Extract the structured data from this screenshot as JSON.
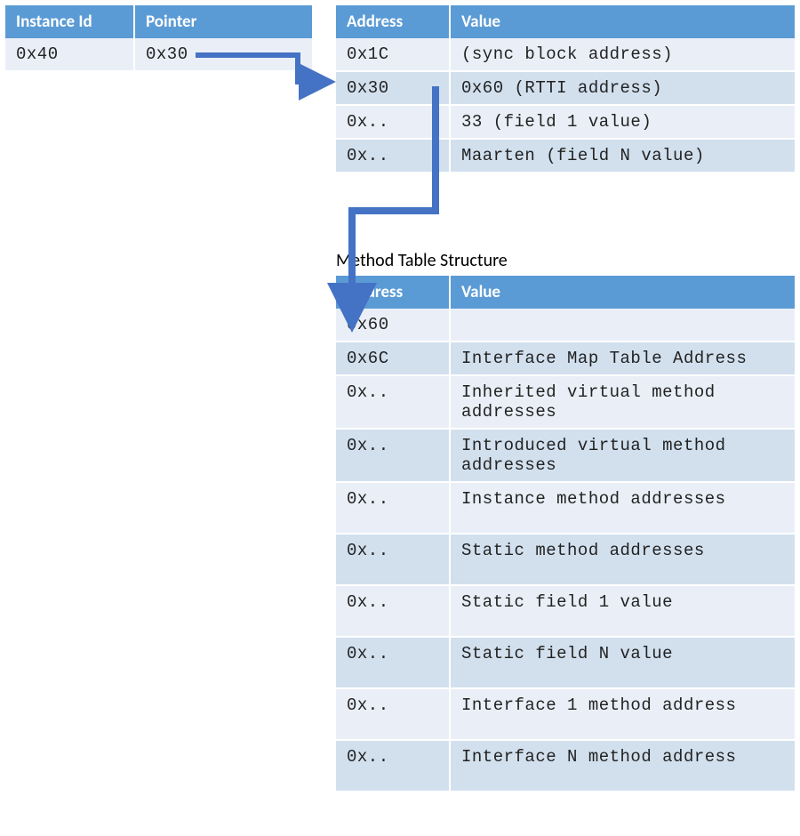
{
  "instanceTable": {
    "headers": [
      "Instance Id",
      "Pointer"
    ],
    "rows": [
      {
        "instanceId": "0x40",
        "pointer": "0x30"
      }
    ]
  },
  "heapTable": {
    "headers": [
      "Address",
      "Value"
    ],
    "rows": [
      {
        "address": "0x1C",
        "value": "(sync block address)"
      },
      {
        "address": "0x30",
        "value": "0x60 (RTTI address)"
      },
      {
        "address": "0x..",
        "value": "33 (field 1 value)"
      },
      {
        "address": "0x..",
        "value": "Maarten (field N value)"
      }
    ]
  },
  "methodTable": {
    "title": "Method Table Structure",
    "headers": [
      "Address",
      "Value"
    ],
    "rows": [
      {
        "address": "0x60",
        "value": ""
      },
      {
        "address": "0x6C",
        "value": "Interface Map Table Address"
      },
      {
        "address": "0x..",
        "value": "Inherited virtual method addresses"
      },
      {
        "address": "0x..",
        "value": "Introduced virtual method addresses"
      },
      {
        "address": "0x..",
        "value": "Instance method addresses"
      },
      {
        "address": "0x..",
        "value": "Static method addresses"
      },
      {
        "address": "0x..",
        "value": "Static field 1 value"
      },
      {
        "address": "0x..",
        "value": "Static field N value"
      },
      {
        "address": "0x..",
        "value": "Interface 1 method address"
      },
      {
        "address": "0x..",
        "value": "Interface N method address"
      }
    ]
  },
  "arrows": {
    "color": "#4472c4"
  }
}
